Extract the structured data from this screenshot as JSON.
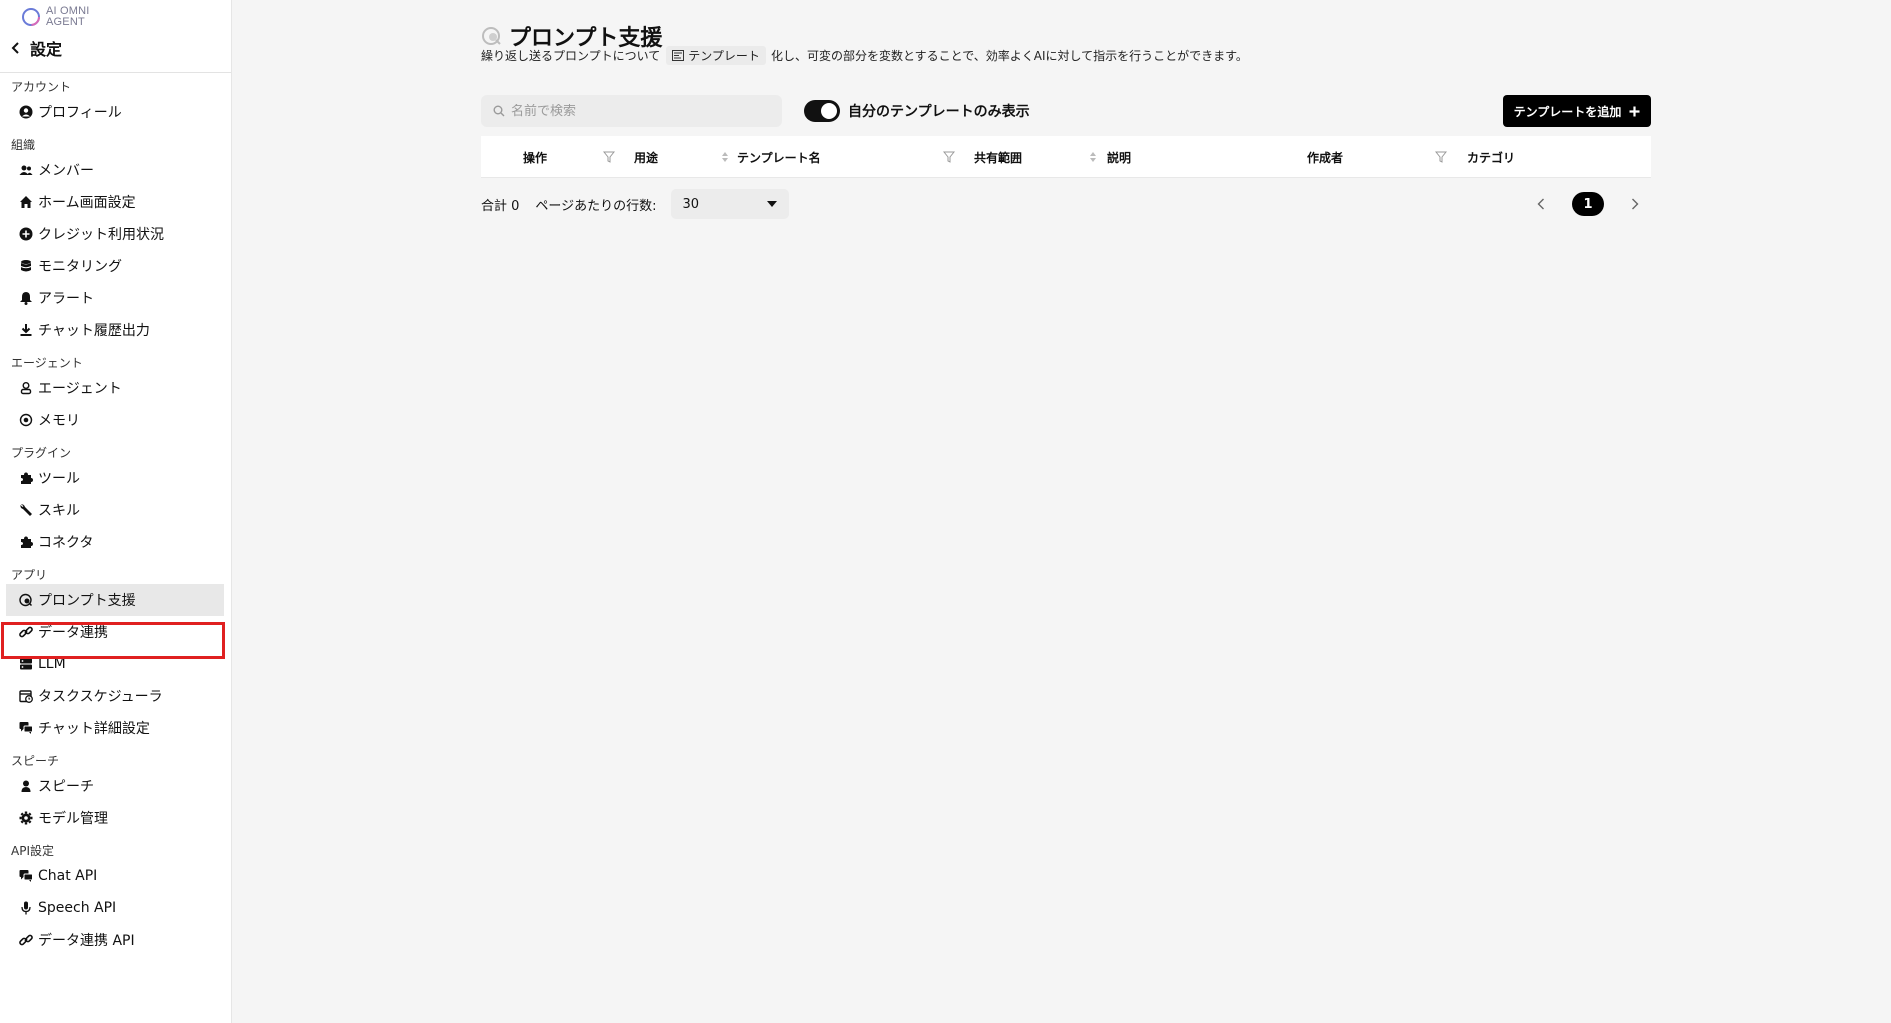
{
  "logo": {
    "line1": "AI OMNI",
    "line2": "AGENT"
  },
  "sidebar": {
    "back_title": "設定",
    "sections": [
      {
        "title": "アカウント",
        "items": [
          {
            "label": "プロフィール",
            "icon": "user-circle-icon"
          }
        ]
      },
      {
        "title": "組織",
        "items": [
          {
            "label": "メンバー",
            "icon": "users-icon"
          },
          {
            "label": "ホーム画面設定",
            "icon": "home-icon"
          },
          {
            "label": "クレジット利用状況",
            "icon": "credit-icon"
          },
          {
            "label": "モニタリング",
            "icon": "database-icon"
          },
          {
            "label": "アラート",
            "icon": "bell-icon"
          },
          {
            "label": "チャット履歴出力",
            "icon": "download-icon"
          }
        ]
      },
      {
        "title": "エージェント",
        "items": [
          {
            "label": "エージェント",
            "icon": "agent-icon"
          },
          {
            "label": "メモリ",
            "icon": "memory-icon"
          }
        ]
      },
      {
        "title": "プラグイン",
        "items": [
          {
            "label": "ツール",
            "icon": "puzzle-icon"
          },
          {
            "label": "スキル",
            "icon": "wrench-icon"
          },
          {
            "label": "コネクタ",
            "icon": "puzzle-icon"
          }
        ]
      },
      {
        "title": "アプリ",
        "items": [
          {
            "label": "プロンプト支援",
            "icon": "prompt-icon",
            "active": true
          },
          {
            "label": "データ連携",
            "icon": "link-icon"
          },
          {
            "label": "LLM",
            "icon": "server-icon"
          },
          {
            "label": "タスクスケジューラ",
            "icon": "calendar-clock-icon"
          },
          {
            "label": "チャット詳細設定",
            "icon": "chat-icon"
          }
        ]
      },
      {
        "title": "スピーチ",
        "items": [
          {
            "label": "スピーチ",
            "icon": "speaker-icon"
          },
          {
            "label": "モデル管理",
            "icon": "gear-icon"
          }
        ]
      },
      {
        "title": "API設定",
        "items": [
          {
            "label": "Chat API",
            "icon": "chat-icon"
          },
          {
            "label": "Speech API",
            "icon": "microphone-icon"
          },
          {
            "label": "データ連携 API",
            "icon": "link-icon"
          }
        ]
      }
    ]
  },
  "page": {
    "title": "プロンプト支援",
    "desc_before": "繰り返し送るプロンプトについて",
    "desc_tag": "テンプレート",
    "desc_after": "化し、可変の部分を変数とすることで、効率よくAIに対して指示を行うことができます。"
  },
  "toolbar": {
    "search_placeholder": "名前で検索",
    "toggle_label": "自分のテンプレートのみ表示",
    "toggle_on": true,
    "add_label": "テンプレートを追加"
  },
  "table": {
    "columns": [
      "操作",
      "用途",
      "テンプレート名",
      "共有範囲",
      "説明",
      "作成者",
      "カテゴリ"
    ]
  },
  "footer": {
    "total_label": "合計 0",
    "rows_label": "ページあたりの行数:",
    "rows_value": "30",
    "current_page": "1"
  },
  "colors": {
    "accent": "#000000",
    "highlight": "#e02020",
    "active_bg": "#e8e8e8"
  }
}
